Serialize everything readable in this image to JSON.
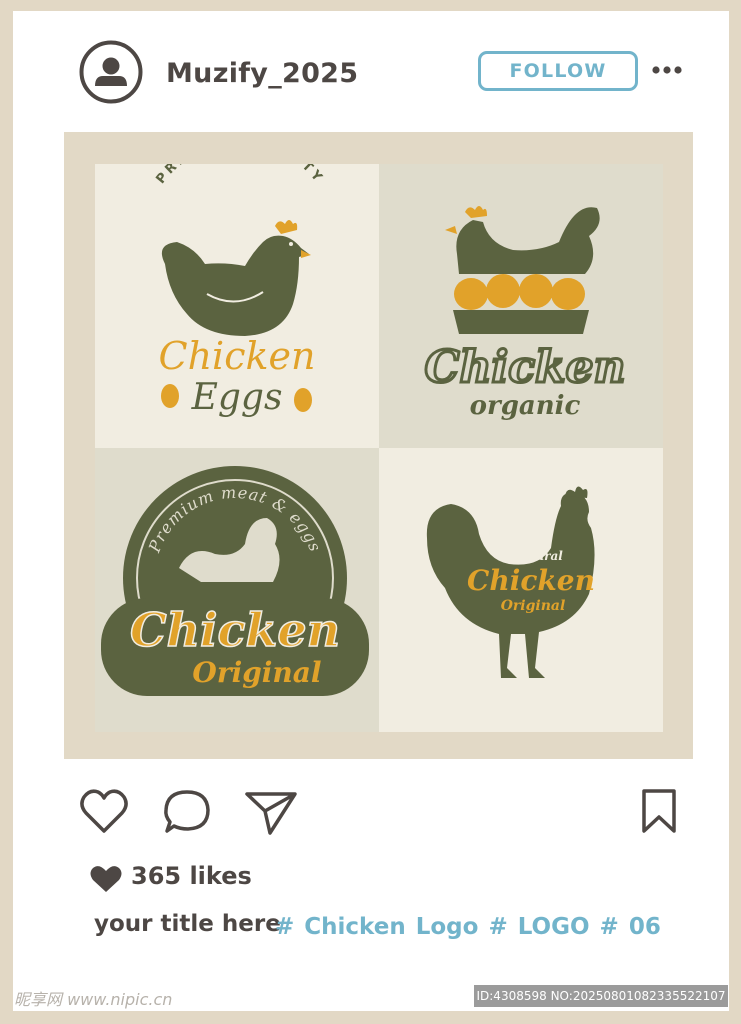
{
  "header": {
    "username": "Muzify_2025",
    "follow_label": "FOLLOW"
  },
  "post": {
    "logos": [
      {
        "arc_text": "PREMIUM QUALITY",
        "title": "Chicken",
        "subtitle": "Eggs"
      },
      {
        "title": "Chicken",
        "subtitle": "organic"
      },
      {
        "arc_text": "Premium meat & eggs",
        "title": "Chicken",
        "subtitle": "Original"
      },
      {
        "small": "Natural",
        "title": "Chicken",
        "subtitle": "Original"
      }
    ],
    "colors": {
      "olive": "#5b6340",
      "gold": "#e1a22a",
      "cream": "#f1ede1"
    }
  },
  "actions": {
    "icons": [
      "heart-icon",
      "comment-icon",
      "share-icon",
      "bookmark-icon"
    ]
  },
  "footer": {
    "likes": "365 likes",
    "caption": "your title here",
    "hashtags": "# Chicken Logo  # LOGO # 06"
  },
  "watermark": {
    "left": "昵享网 www.nipic.cn",
    "right": "ID:4308598 NO:20250801082335522107"
  }
}
